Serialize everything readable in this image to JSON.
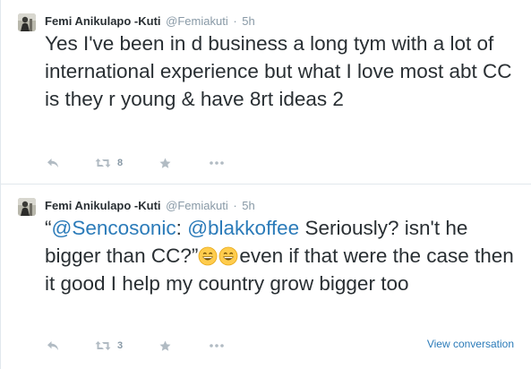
{
  "tweets": [
    {
      "author": {
        "name": "Femi Anikulapo -Kuti",
        "handle": "@Femiakuti"
      },
      "separator": "·",
      "time": "5h",
      "text": "Yes I've been in d business a long tym with a lot of international experience but what I love most abt CC is they r young & have 8rt ideas 2",
      "retweet_count": "8",
      "favorite_count": ""
    },
    {
      "author": {
        "name": "Femi Anikulapo -Kuti",
        "handle": "@Femiakuti"
      },
      "separator": "·",
      "time": "5h",
      "text_parts": {
        "open_quote": "“",
        "mention1": "@Sencosonic",
        "colon": ": ",
        "mention2": "@blakkoffee",
        "quoted": " Seriously? isn't he bigger than CC?”",
        "rest": "even if that were the case then it good I help my country grow bigger too"
      },
      "emojis": [
        "grinning-face-emoji",
        "grinning-face-emoji"
      ],
      "retweet_count": "3",
      "favorite_count": "",
      "view_conversation_label": "View conversation"
    }
  ],
  "icons": {
    "reply": "reply-icon",
    "retweet": "retweet-icon",
    "favorite": "star-icon",
    "more": "more-icon"
  },
  "colors": {
    "link": "#2b7bb9",
    "text": "#292f33",
    "muted": "#8899a6",
    "icon": "#b1bbc3",
    "divider": "#e1e8ed"
  }
}
